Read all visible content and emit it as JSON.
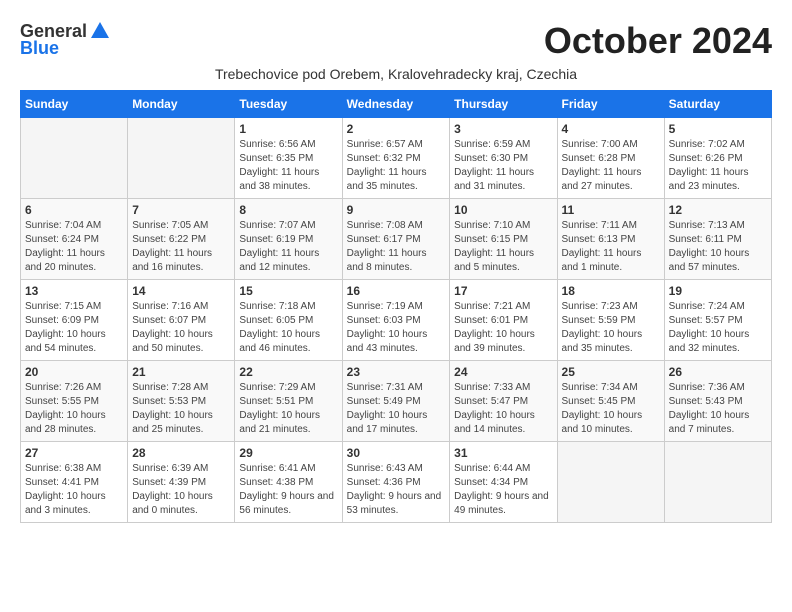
{
  "logo": {
    "general": "General",
    "blue": "Blue"
  },
  "title": "October 2024",
  "subtitle": "Trebechovice pod Orebem, Kralovehradecky kraj, Czechia",
  "days_of_week": [
    "Sunday",
    "Monday",
    "Tuesday",
    "Wednesday",
    "Thursday",
    "Friday",
    "Saturday"
  ],
  "weeks": [
    [
      {
        "day": null
      },
      {
        "day": null
      },
      {
        "day": 1,
        "sunrise": "Sunrise: 6:56 AM",
        "sunset": "Sunset: 6:35 PM",
        "daylight": "Daylight: 11 hours and 38 minutes."
      },
      {
        "day": 2,
        "sunrise": "Sunrise: 6:57 AM",
        "sunset": "Sunset: 6:32 PM",
        "daylight": "Daylight: 11 hours and 35 minutes."
      },
      {
        "day": 3,
        "sunrise": "Sunrise: 6:59 AM",
        "sunset": "Sunset: 6:30 PM",
        "daylight": "Daylight: 11 hours and 31 minutes."
      },
      {
        "day": 4,
        "sunrise": "Sunrise: 7:00 AM",
        "sunset": "Sunset: 6:28 PM",
        "daylight": "Daylight: 11 hours and 27 minutes."
      },
      {
        "day": 5,
        "sunrise": "Sunrise: 7:02 AM",
        "sunset": "Sunset: 6:26 PM",
        "daylight": "Daylight: 11 hours and 23 minutes."
      }
    ],
    [
      {
        "day": 6,
        "sunrise": "Sunrise: 7:04 AM",
        "sunset": "Sunset: 6:24 PM",
        "daylight": "Daylight: 11 hours and 20 minutes."
      },
      {
        "day": 7,
        "sunrise": "Sunrise: 7:05 AM",
        "sunset": "Sunset: 6:22 PM",
        "daylight": "Daylight: 11 hours and 16 minutes."
      },
      {
        "day": 8,
        "sunrise": "Sunrise: 7:07 AM",
        "sunset": "Sunset: 6:19 PM",
        "daylight": "Daylight: 11 hours and 12 minutes."
      },
      {
        "day": 9,
        "sunrise": "Sunrise: 7:08 AM",
        "sunset": "Sunset: 6:17 PM",
        "daylight": "Daylight: 11 hours and 8 minutes."
      },
      {
        "day": 10,
        "sunrise": "Sunrise: 7:10 AM",
        "sunset": "Sunset: 6:15 PM",
        "daylight": "Daylight: 11 hours and 5 minutes."
      },
      {
        "day": 11,
        "sunrise": "Sunrise: 7:11 AM",
        "sunset": "Sunset: 6:13 PM",
        "daylight": "Daylight: 11 hours and 1 minute."
      },
      {
        "day": 12,
        "sunrise": "Sunrise: 7:13 AM",
        "sunset": "Sunset: 6:11 PM",
        "daylight": "Daylight: 10 hours and 57 minutes."
      }
    ],
    [
      {
        "day": 13,
        "sunrise": "Sunrise: 7:15 AM",
        "sunset": "Sunset: 6:09 PM",
        "daylight": "Daylight: 10 hours and 54 minutes."
      },
      {
        "day": 14,
        "sunrise": "Sunrise: 7:16 AM",
        "sunset": "Sunset: 6:07 PM",
        "daylight": "Daylight: 10 hours and 50 minutes."
      },
      {
        "day": 15,
        "sunrise": "Sunrise: 7:18 AM",
        "sunset": "Sunset: 6:05 PM",
        "daylight": "Daylight: 10 hours and 46 minutes."
      },
      {
        "day": 16,
        "sunrise": "Sunrise: 7:19 AM",
        "sunset": "Sunset: 6:03 PM",
        "daylight": "Daylight: 10 hours and 43 minutes."
      },
      {
        "day": 17,
        "sunrise": "Sunrise: 7:21 AM",
        "sunset": "Sunset: 6:01 PM",
        "daylight": "Daylight: 10 hours and 39 minutes."
      },
      {
        "day": 18,
        "sunrise": "Sunrise: 7:23 AM",
        "sunset": "Sunset: 5:59 PM",
        "daylight": "Daylight: 10 hours and 35 minutes."
      },
      {
        "day": 19,
        "sunrise": "Sunrise: 7:24 AM",
        "sunset": "Sunset: 5:57 PM",
        "daylight": "Daylight: 10 hours and 32 minutes."
      }
    ],
    [
      {
        "day": 20,
        "sunrise": "Sunrise: 7:26 AM",
        "sunset": "Sunset: 5:55 PM",
        "daylight": "Daylight: 10 hours and 28 minutes."
      },
      {
        "day": 21,
        "sunrise": "Sunrise: 7:28 AM",
        "sunset": "Sunset: 5:53 PM",
        "daylight": "Daylight: 10 hours and 25 minutes."
      },
      {
        "day": 22,
        "sunrise": "Sunrise: 7:29 AM",
        "sunset": "Sunset: 5:51 PM",
        "daylight": "Daylight: 10 hours and 21 minutes."
      },
      {
        "day": 23,
        "sunrise": "Sunrise: 7:31 AM",
        "sunset": "Sunset: 5:49 PM",
        "daylight": "Daylight: 10 hours and 17 minutes."
      },
      {
        "day": 24,
        "sunrise": "Sunrise: 7:33 AM",
        "sunset": "Sunset: 5:47 PM",
        "daylight": "Daylight: 10 hours and 14 minutes."
      },
      {
        "day": 25,
        "sunrise": "Sunrise: 7:34 AM",
        "sunset": "Sunset: 5:45 PM",
        "daylight": "Daylight: 10 hours and 10 minutes."
      },
      {
        "day": 26,
        "sunrise": "Sunrise: 7:36 AM",
        "sunset": "Sunset: 5:43 PM",
        "daylight": "Daylight: 10 hours and 7 minutes."
      }
    ],
    [
      {
        "day": 27,
        "sunrise": "Sunrise: 6:38 AM",
        "sunset": "Sunset: 4:41 PM",
        "daylight": "Daylight: 10 hours and 3 minutes."
      },
      {
        "day": 28,
        "sunrise": "Sunrise: 6:39 AM",
        "sunset": "Sunset: 4:39 PM",
        "daylight": "Daylight: 10 hours and 0 minutes."
      },
      {
        "day": 29,
        "sunrise": "Sunrise: 6:41 AM",
        "sunset": "Sunset: 4:38 PM",
        "daylight": "Daylight: 9 hours and 56 minutes."
      },
      {
        "day": 30,
        "sunrise": "Sunrise: 6:43 AM",
        "sunset": "Sunset: 4:36 PM",
        "daylight": "Daylight: 9 hours and 53 minutes."
      },
      {
        "day": 31,
        "sunrise": "Sunrise: 6:44 AM",
        "sunset": "Sunset: 4:34 PM",
        "daylight": "Daylight: 9 hours and 49 minutes."
      },
      {
        "day": null
      },
      {
        "day": null
      }
    ]
  ]
}
